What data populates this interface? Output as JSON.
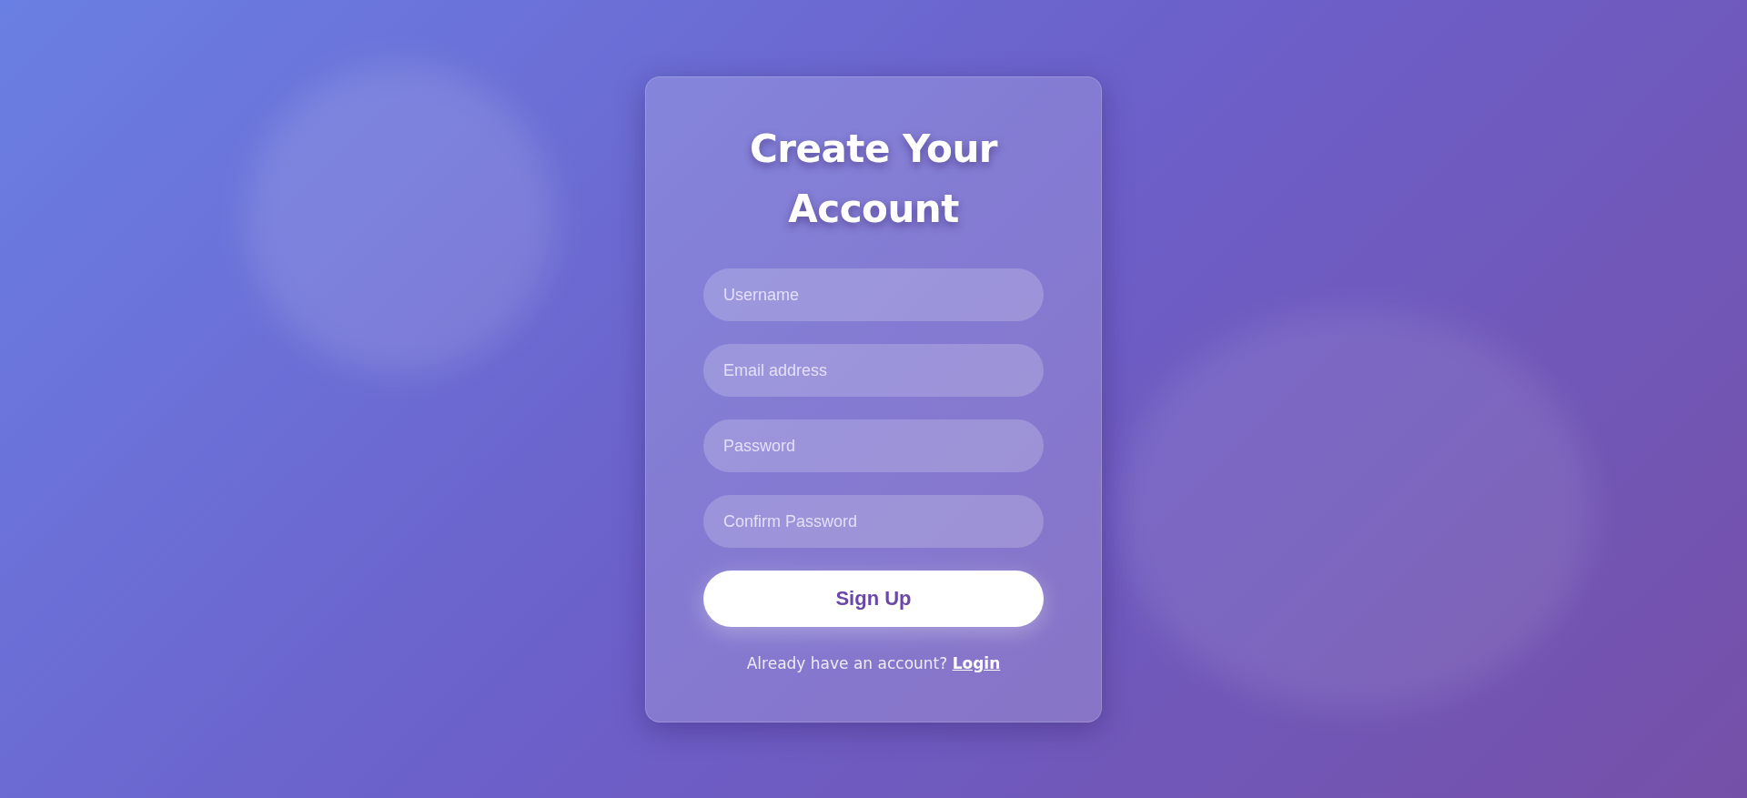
{
  "card": {
    "title": "Create Your Account",
    "fields": [
      {
        "placeholder": "Username"
      },
      {
        "placeholder": "Email address"
      },
      {
        "placeholder": "Password"
      },
      {
        "placeholder": "Confirm Password"
      }
    ],
    "button": "Sign Up",
    "footer": {
      "text": "Already have an account?",
      "link": "Login"
    }
  }
}
